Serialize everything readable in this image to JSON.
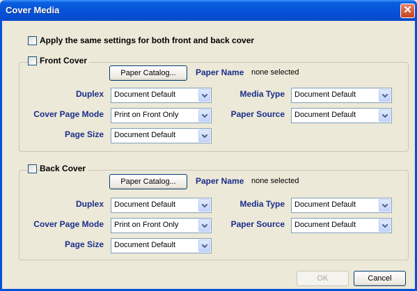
{
  "window": {
    "title": "Cover Media",
    "close_glyph": "✕"
  },
  "apply_same": {
    "label": "Apply the same settings for both front and back cover",
    "checked": false
  },
  "front": {
    "title": "Front Cover",
    "checked": false,
    "paper_catalog_button": "Paper Catalog...",
    "paper_name_label": "Paper Name",
    "paper_name_value": "none selected",
    "duplex_label": "Duplex",
    "duplex_value": "Document Default",
    "cover_mode_label": "Cover Page Mode",
    "cover_mode_value": "Print on Front Only",
    "page_size_label": "Page Size",
    "page_size_value": "Document Default",
    "media_type_label": "Media Type",
    "media_type_value": "Document Default",
    "paper_source_label": "Paper Source",
    "paper_source_value": "Document Default"
  },
  "back": {
    "title": "Back Cover",
    "checked": false,
    "paper_catalog_button": "Paper Catalog...",
    "paper_name_label": "Paper Name",
    "paper_name_value": "none selected",
    "duplex_label": "Duplex",
    "duplex_value": "Document Default",
    "cover_mode_label": "Cover Page Mode",
    "cover_mode_value": "Print on Front Only",
    "page_size_label": "Page Size",
    "page_size_value": "Document Default",
    "media_type_label": "Media Type",
    "media_type_value": "Document Default",
    "paper_source_label": "Paper Source",
    "paper_source_value": "Document Default"
  },
  "buttons": {
    "ok": "OK",
    "cancel": "Cancel",
    "ok_enabled": false
  },
  "colors": {
    "titlebar": "#0550d8",
    "label_blue": "#1a2d8a",
    "dialog_bg": "#ece9d8"
  }
}
